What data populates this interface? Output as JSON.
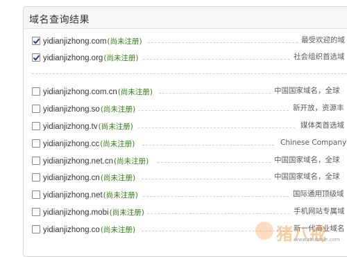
{
  "panel": {
    "title": "域名查询结果"
  },
  "results": [
    {
      "domain": "yidianjizhong.com",
      "status": "(尚未注册)",
      "desc": "最受欢迎的域",
      "checked": true
    },
    {
      "domain": "yidianjizhong.org",
      "status": "(尚未注册)",
      "desc": "社会组织首选域",
      "checked": true
    },
    {
      "domain": "yidianjizhong.com.cn",
      "status": "(尚未注册)",
      "desc": "中国国家域名，全球",
      "checked": false
    },
    {
      "domain": "yidianjizhong.so",
      "status": "(尚未注册)",
      "desc": "新开放，资源丰",
      "checked": false
    },
    {
      "domain": "yidianjizhong.tv",
      "status": "(尚未注册)",
      "desc": "媒体类首选域",
      "checked": false
    },
    {
      "domain": "yidianjizhong.cc",
      "status": "(尚未注册)",
      "desc": "Chinese Company缩",
      "checked": false
    },
    {
      "domain": "yidianjizhong.net.cn",
      "status": "(尚未注册)",
      "desc": "中国国家域名，全球",
      "checked": false
    },
    {
      "domain": "yidianjizhong.cn",
      "status": "(尚未注册)",
      "desc": "中国国家域名，全球",
      "checked": false
    },
    {
      "domain": "yidianjizhong.net",
      "status": "(尚未注册)",
      "desc": "国际通用顶级域",
      "checked": false
    },
    {
      "domain": "yidianjizhong.mobi",
      "status": "(尚未注册)",
      "desc": "手机网站专属域",
      "checked": false
    },
    {
      "domain": "yidianjizhong.co",
      "status": "(尚未注册)",
      "desc": "新一代商业域名",
      "checked": false
    }
  ],
  "watermark": {
    "brand": "猪八戒",
    "url": "www.zhubajie.com"
  },
  "colors": {
    "status_green": "#2f7d14",
    "header_bg": "#f6f6f6",
    "border": "#d4d4d4"
  }
}
